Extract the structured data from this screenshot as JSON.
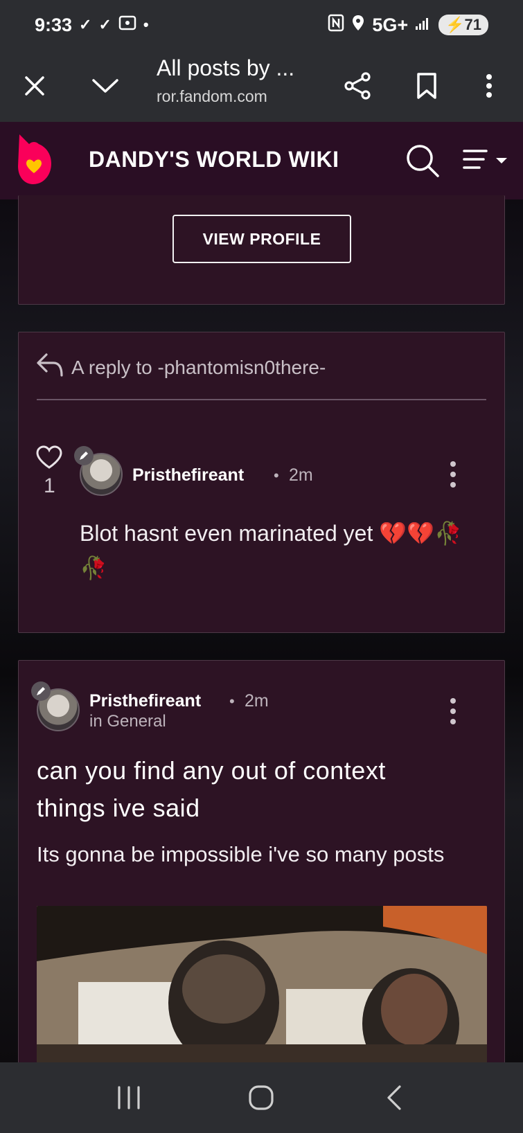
{
  "status_bar": {
    "time": "9:33",
    "network": "5G+",
    "battery": "71"
  },
  "browser": {
    "title": "All posts by ...",
    "url": "ror.fandom.com"
  },
  "wiki": {
    "title": "DANDY'S WORLD WIKI",
    "brand_color": "#fa005a"
  },
  "profile_card": {
    "view_profile_label": "VIEW PROFILE"
  },
  "reply_post": {
    "reply_to": "A reply to -phantomisn0there-",
    "likes": "1",
    "username": "Pristhefireant",
    "time": "2m",
    "body": "Blot hasnt even marinated yet 💔💔🥀🥀"
  },
  "main_post": {
    "username": "Pristhefireant",
    "time": "2m",
    "category": "in General",
    "title": "can you find any out of context things ive said",
    "body": "Its gonna be impossible i've so many posts"
  },
  "colors": {
    "card_bg": "#2d1324",
    "header_bg": "#2a0e24",
    "system_bar": "#2c2d31"
  }
}
